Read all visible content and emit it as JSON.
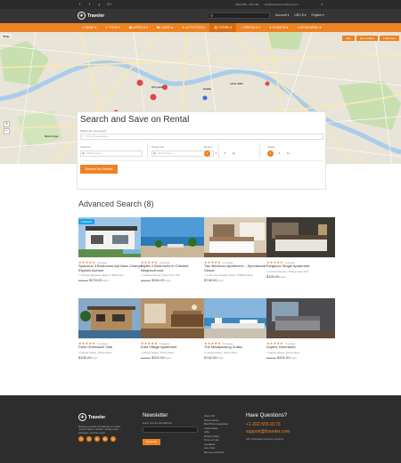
{
  "topbar": {
    "social": [
      "f",
      "t",
      "y",
      "G+"
    ],
    "phone": "(000) 999 - 456 789",
    "email": "info@travelerwordpress.com",
    "right": "♥"
  },
  "header": {
    "logo_text": "Traveler",
    "logo_mark": "✈",
    "search_icon": "⚲",
    "account": "Account ▾",
    "currency": "USD $ ▾",
    "language": "English ▾"
  },
  "nav": [
    {
      "label": "⌂ HOME ▾",
      "active": false
    },
    {
      "label": "✈ TOUR ▾",
      "active": false
    },
    {
      "label": "▦ HOTELS ▾",
      "active": false
    },
    {
      "label": "⛟ CARS ▾",
      "active": false
    },
    {
      "label": "★ ACTIVITIES ▾",
      "active": false
    },
    {
      "label": "⛴ TOURS ▾",
      "active": true
    },
    {
      "label": "⌂ RENTALS ▾",
      "active": false
    },
    {
      "label": "✈ FLIGHTS ▾",
      "active": false
    },
    {
      "label": "≡ MEGA MENU ▾",
      "active": false
    }
  ],
  "map": {
    "title": "Map",
    "buttons": [
      "Hide",
      "My Location",
      "Fullscreen"
    ],
    "labels": [
      "PARIS",
      "6TH ARR.",
      "11TH ARR.",
      "12TH ARR.",
      "15TH ARR.",
      "Montrouge"
    ]
  },
  "search": {
    "title": "Search and Save on Rental",
    "question": "Where are you going?",
    "city_placeholder": "City or Destination",
    "checkin_label": "Check In",
    "checkin_placeholder": "dd/mm/yyyy",
    "checkout_label": "Check Out",
    "checkout_placeholder": "dd/mm/yyyy",
    "rooms_label": "Rooms",
    "rooms_options": [
      "1",
      "2",
      "3",
      "3+"
    ],
    "adults_label": "Adults",
    "adults_options": [
      "1",
      "2",
      "3+"
    ],
    "button": "Search for Rental"
  },
  "advanced": {
    "title": "Advanced Search (8)"
  },
  "cards": [
    {
      "name": "Spacious 3 Bedrooms Apt Near Champs Elysées Avenue",
      "badge": "Featured",
      "stars": "★★★★★",
      "reviews": "3 review",
      "location": "Champs Elysées, Allée Fr Brabonne",
      "old_price": "$699.00",
      "price": "$278.00",
      "unit": "/night",
      "thumb": 1
    },
    {
      "name": "Stylist 2 Bedrooms in Chelsea Neighborhood",
      "badge": "",
      "stars": "★★★★★",
      "reviews": "3 review",
      "location": "Chelsea Street, New York USA",
      "old_price": "$469.00",
      "price": "$346.00",
      "unit": "/night",
      "thumb": 2
    },
    {
      "name": "Two Bedroom Apartment – Spectacular Views!",
      "badge": "",
      "stars": "★★★★★",
      "reviews": "3 review",
      "location": "1 Rue De Vezelay, Paris, 75008 France",
      "old_price": "",
      "price": "$748.00",
      "unit": "/night",
      "thumb": 3
    },
    {
      "name": "Elegance Single Apartment",
      "badge": "",
      "stars": "★★★★★",
      "reviews": "3 review",
      "location": "1 Hotel Avenue, Thiene New York",
      "old_price": "",
      "price": "$326.00",
      "unit": "/night",
      "thumb": 4
    },
    {
      "name": "Paris Greenwich Villa",
      "badge": "",
      "stars": "★★★★★",
      "reviews": "3 review",
      "location": "Heinie Abuse, Porse Abee",
      "old_price": "",
      "price": "$195.00",
      "unit": "/night",
      "thumb": 5
    },
    {
      "name": "East Village Apartment",
      "badge": "",
      "stars": "★★★★★",
      "reviews": "3 review",
      "location": "Heinie Abuse, Porse Abee",
      "old_price": "$443.00",
      "price": "$252.00",
      "unit": "/night",
      "thumb": 6
    },
    {
      "name": "The Meatpacking Suites",
      "badge": "",
      "stars": "★★★★★",
      "reviews": "3 review",
      "location": "Heinie Abuse, Porse Abee",
      "old_price": "",
      "price": "$742.00",
      "unit": "/night",
      "thumb": 7
    },
    {
      "name": "Duplex Greenwich",
      "badge": "",
      "stars": "★★★★★",
      "reviews": "3 review",
      "location": "Heinie Abuse, Porse Abee",
      "old_price": "$429.00",
      "price": "$326.00",
      "unit": "/night",
      "thumb": 8
    }
  ],
  "footer": {
    "logo_text": "Traveler",
    "logo_mark": "✈",
    "description": "Booking, reviews and advices on hotels, resorts, flights, vacation rentals, travel packages, and lots more!",
    "social": [
      "f",
      "t",
      "in",
      "G+",
      "p"
    ],
    "newsletter_title": "Newsletter",
    "newsletter_label": "Enter your E-mail Address",
    "newsletter_placeholder": "",
    "newsletter_button": "Subscribe",
    "links": [
      "About US",
      "Press Centre",
      "Best Price Guarantee",
      "Travel News",
      "Jobs",
      "Privacy Policy",
      "Terms of Use",
      "Feedback",
      "Live Chat",
      "Become a Partner"
    ],
    "hq_title": "Have Questions?",
    "hq_phone": "+1-202-555-0173",
    "hq_email": "support@traveler.com",
    "hq_note": "24/7 Dedicated Customer Support"
  }
}
